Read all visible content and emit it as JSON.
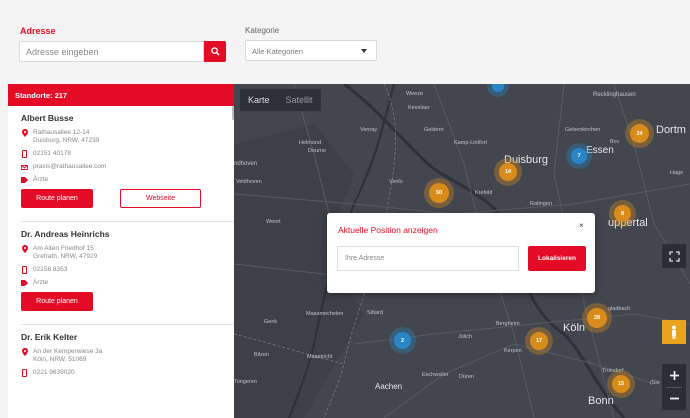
{
  "filters": {
    "address_label": "Adresse",
    "address_placeholder": "Adresse eingeben",
    "category_label": "Kategorie",
    "category_selected": "Alle Kategorien"
  },
  "sidebar": {
    "header": "Standorte: 217",
    "entries": [
      {
        "name": "Albert Busse",
        "address_line1": "Rathausallee 12-14",
        "address_line2": "Duisburg, NRW, 47239",
        "phone": "02151 40178",
        "email": "praxis@rathausallee.com",
        "category": "Ärzte",
        "route_label": "Route planen",
        "website_label": "Webseite"
      },
      {
        "name": "Dr. Andreas Heinrichs",
        "address_line1": "Am Alten Friedhof 15",
        "address_line2": "Grefrath, NRW, 47929",
        "phone": "02158 8353",
        "category": "Ärzte",
        "route_label": "Route planen"
      },
      {
        "name": "Dr. Erik Kelter",
        "address_line1": "An der Kemperwiese 3a",
        "address_line2": "Köln, NRW, 51069",
        "phone": "0221 9639020"
      }
    ]
  },
  "map": {
    "map_type_map": "Karte",
    "map_type_satellite": "Satellit",
    "towns": {
      "recklinghausen": "Recklinghausen",
      "dortmund": "Dortm",
      "gelsenkirchen": "Gelsenkirchen",
      "bochum": "Boc",
      "duisburg": "Duisburg",
      "essen": "Essen",
      "venlo": "Venlo",
      "krefeld": "Krefeld",
      "ratingen": "Ratingen",
      "hagen": "Hage",
      "wuppertal": "uppertal",
      "eindhoven": "ndhoven",
      "weeze": "Weeze",
      "kevelaer": "Kevelaer",
      "geldern": "Geldern",
      "helmond": "Helmond",
      "deurne": "Deurne",
      "venray": "Venray",
      "kamp_lintfort": "Kamp-Lintfort",
      "veldhoven": "Veldhoven",
      "weert": "Weert",
      "masmechelen": "Maasmechelen",
      "genk": "Genk",
      "sittard": "Sittard",
      "bilzen": "Bilzen",
      "maastricht": "Maastricht",
      "bergheim": "Bergheim",
      "juelich": "Jülich",
      "eschweiler": "Eschweiler",
      "dueren": "Düren",
      "aachen": "Aachen",
      "kerpen": "Kerpen",
      "koeln": "Köln",
      "bonn": "Bonn",
      "troisdorf": "Troisdorf",
      "tongeren": "Tongeren",
      "gladbach": "gladbach",
      "sieg": "(Sie"
    },
    "clusters": {
      "c1": "50",
      "c2": "14",
      "c3": "24",
      "c4": "7",
      "c5": "8",
      "c6": "2",
      "c7": "17",
      "c8": "28",
      "c9": "15",
      "c10": ""
    }
  },
  "modal": {
    "title": "Aktuelle Position anzeigen",
    "close": "×",
    "input_placeholder": "Ihre Adresse",
    "button": "Lokalisieren"
  },
  "colors": {
    "accent": "#e30b25",
    "map_bg": "#43464f",
    "cluster_orange": "#d98c1b",
    "cluster_blue": "#2a86c4"
  }
}
